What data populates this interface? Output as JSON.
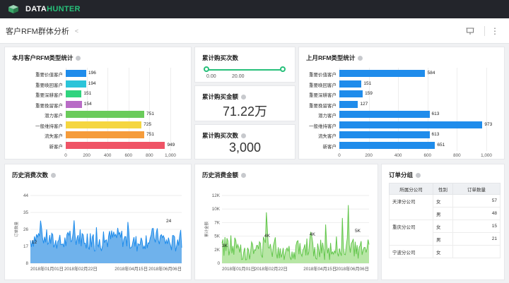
{
  "app": {
    "logo_prefix": "DATA",
    "logo_suffix": "HUNTER"
  },
  "page": {
    "title": "客户RFM群体分析"
  },
  "colors": {
    "blue": "#1f8ceb",
    "green": "#7ed36a",
    "accent": "#27c07a"
  },
  "panels": {
    "current_rfm": {
      "title": "本月客户RFM类型统计",
      "x_ticks": [
        "0",
        "200",
        "400",
        "600",
        "800",
        "1,000"
      ]
    },
    "cum_count_slider": {
      "title": "累计购买次数",
      "min_label": "0.00",
      "max_label": "20.00"
    },
    "cum_amount": {
      "title": "累计购买金额",
      "value": "71.22万"
    },
    "cum_count": {
      "title": "累计购买次数",
      "value": "3,000"
    },
    "last_rfm": {
      "title": "上月RFM类型统计",
      "x_ticks": [
        "0",
        "200",
        "400",
        "600",
        "800",
        "1,000"
      ]
    },
    "hist_count": {
      "title": "历史消费次数",
      "ylabel": "订单数量",
      "y_ticks": [
        "44",
        "35",
        "26",
        "17",
        "8"
      ],
      "x_ticks": [
        "2018年01月01日",
        "2018年02月22日",
        "2018年04月15日",
        "2018年06月06日"
      ],
      "labels": [
        "12",
        "24"
      ]
    },
    "hist_amount": {
      "title": "历史消费金额",
      "ylabel": "累计金额",
      "y_ticks": [
        "12K",
        "10K",
        "7K",
        "5K",
        "2K",
        "0"
      ],
      "x_ticks": [
        "2018年01月01日",
        "2018年02月22日",
        "2018年04月15日",
        "2018年06月06日"
      ],
      "labels": [
        "3K",
        "4K",
        "4K",
        "5K"
      ]
    },
    "orders": {
      "title": "订单分组",
      "headers": [
        "所属分公司",
        "性别",
        "订单数量"
      ],
      "rows": [
        {
          "company": "天津分公司",
          "gender": "女",
          "count": "57"
        },
        {
          "company": "",
          "gender": "男",
          "count": "48"
        },
        {
          "company": "重庆分公司",
          "gender": "女",
          "count": "15"
        },
        {
          "company": "",
          "gender": "男",
          "count": "21"
        },
        {
          "company": "宁波分公司",
          "gender": "女",
          "count": ""
        }
      ]
    }
  },
  "chart_data": [
    {
      "type": "bar",
      "title": "本月客户RFM类型统计",
      "categories": [
        "重要价值客户",
        "重要唤回客户",
        "重要深耕客户",
        "重要挽留客户",
        "潜力客户",
        "一般维持客户",
        "流失客户",
        "新客户"
      ],
      "values": [
        196,
        194,
        151,
        154,
        751,
        725,
        751,
        949
      ],
      "colors": [
        "#1f8ceb",
        "#2bc4d9",
        "#2fd47e",
        "#b86bc6",
        "#6acb5a",
        "#f5d640",
        "#f59c3b",
        "#ef5466"
      ],
      "xlim": [
        0,
        1000
      ]
    },
    {
      "type": "bar",
      "title": "上月RFM类型统计",
      "categories": [
        "重要价值客户",
        "重要唤回客户",
        "重要深耕客户",
        "重要挽留客户",
        "潜力客户",
        "一般维持客户",
        "流失客户",
        "新客户"
      ],
      "values": [
        584,
        151,
        159,
        127,
        613,
        973,
        613,
        651
      ],
      "colors": [
        "#1f8ceb"
      ],
      "xlim": [
        0,
        1000
      ]
    }
  ]
}
